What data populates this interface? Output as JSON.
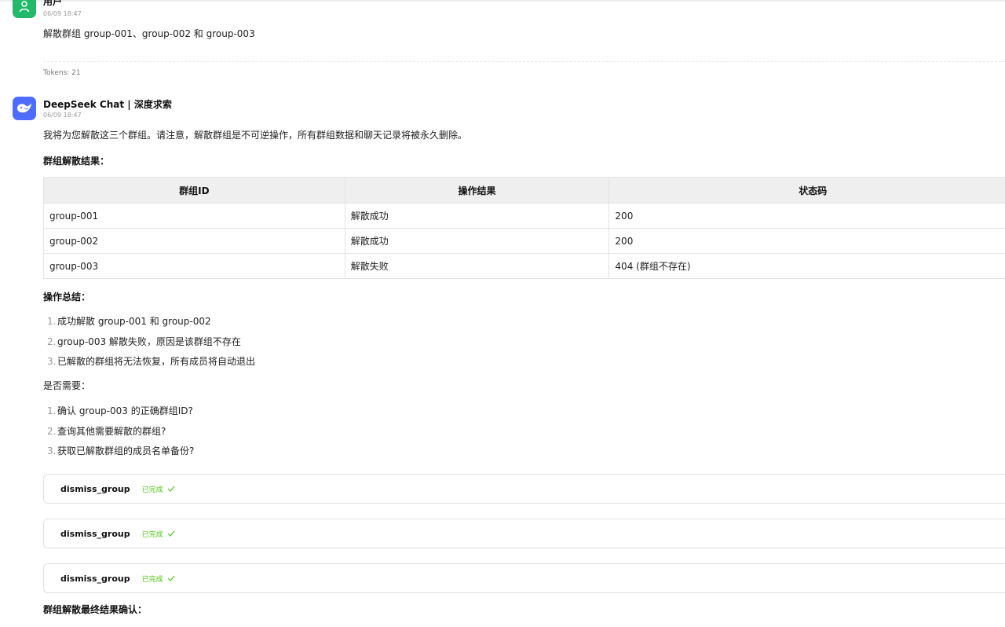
{
  "user_message": {
    "name": "用户",
    "time": "06/09 18:47",
    "text": "解散群组 group-001、group-002 和 group-003",
    "tokens": "Tokens: 21"
  },
  "assistant_message": {
    "name": "DeepSeek Chat | 深度求索",
    "time": "06/09 18:47",
    "intro": "我将为您解散这三个群组。请注意，解散群组是不可逆操作，所有群组数据和聊天记录将被永久删除。",
    "result_heading": "群组解散结果：",
    "table": {
      "headers": [
        "群组ID",
        "操作结果",
        "状态码"
      ],
      "rows": [
        [
          "group-001",
          "解散成功",
          "200"
        ],
        [
          "group-002",
          "解散成功",
          "200"
        ],
        [
          "group-003",
          "解散失败",
          "404 (群组不存在)"
        ]
      ]
    },
    "summary_heading": "操作总结：",
    "summary_items": [
      {
        "num": "1.",
        "text": "成功解散 group-001 和 group-002"
      },
      {
        "num": "2.",
        "text": "group-003 解散失败，原因是该群组不存在"
      },
      {
        "num": "3.",
        "text": "已解散的群组将无法恢复，所有成员将自动退出"
      }
    ],
    "question": "是否需要：",
    "question_items": [
      {
        "num": "1.",
        "text": "确认 group-003 的正确群组ID?"
      },
      {
        "num": "2.",
        "text": "查询其他需要解散的群组?"
      },
      {
        "num": "3.",
        "text": "获取已解散群组的成员名单备份?"
      }
    ],
    "tool_calls": [
      {
        "name": "dismiss_group",
        "status": "已完成"
      },
      {
        "name": "dismiss_group",
        "status": "已完成"
      },
      {
        "name": "dismiss_group",
        "status": "已完成"
      }
    ],
    "final_heading": "群组解散最终结果确认："
  },
  "colors": {
    "user_avatar": "#22b96a",
    "bot_avatar": "#4d6bfe",
    "success": "#52c41a"
  },
  "icons": {
    "user_avatar": "user-icon",
    "bot_avatar": "whale-logo-icon",
    "tool_done": "check-icon"
  }
}
